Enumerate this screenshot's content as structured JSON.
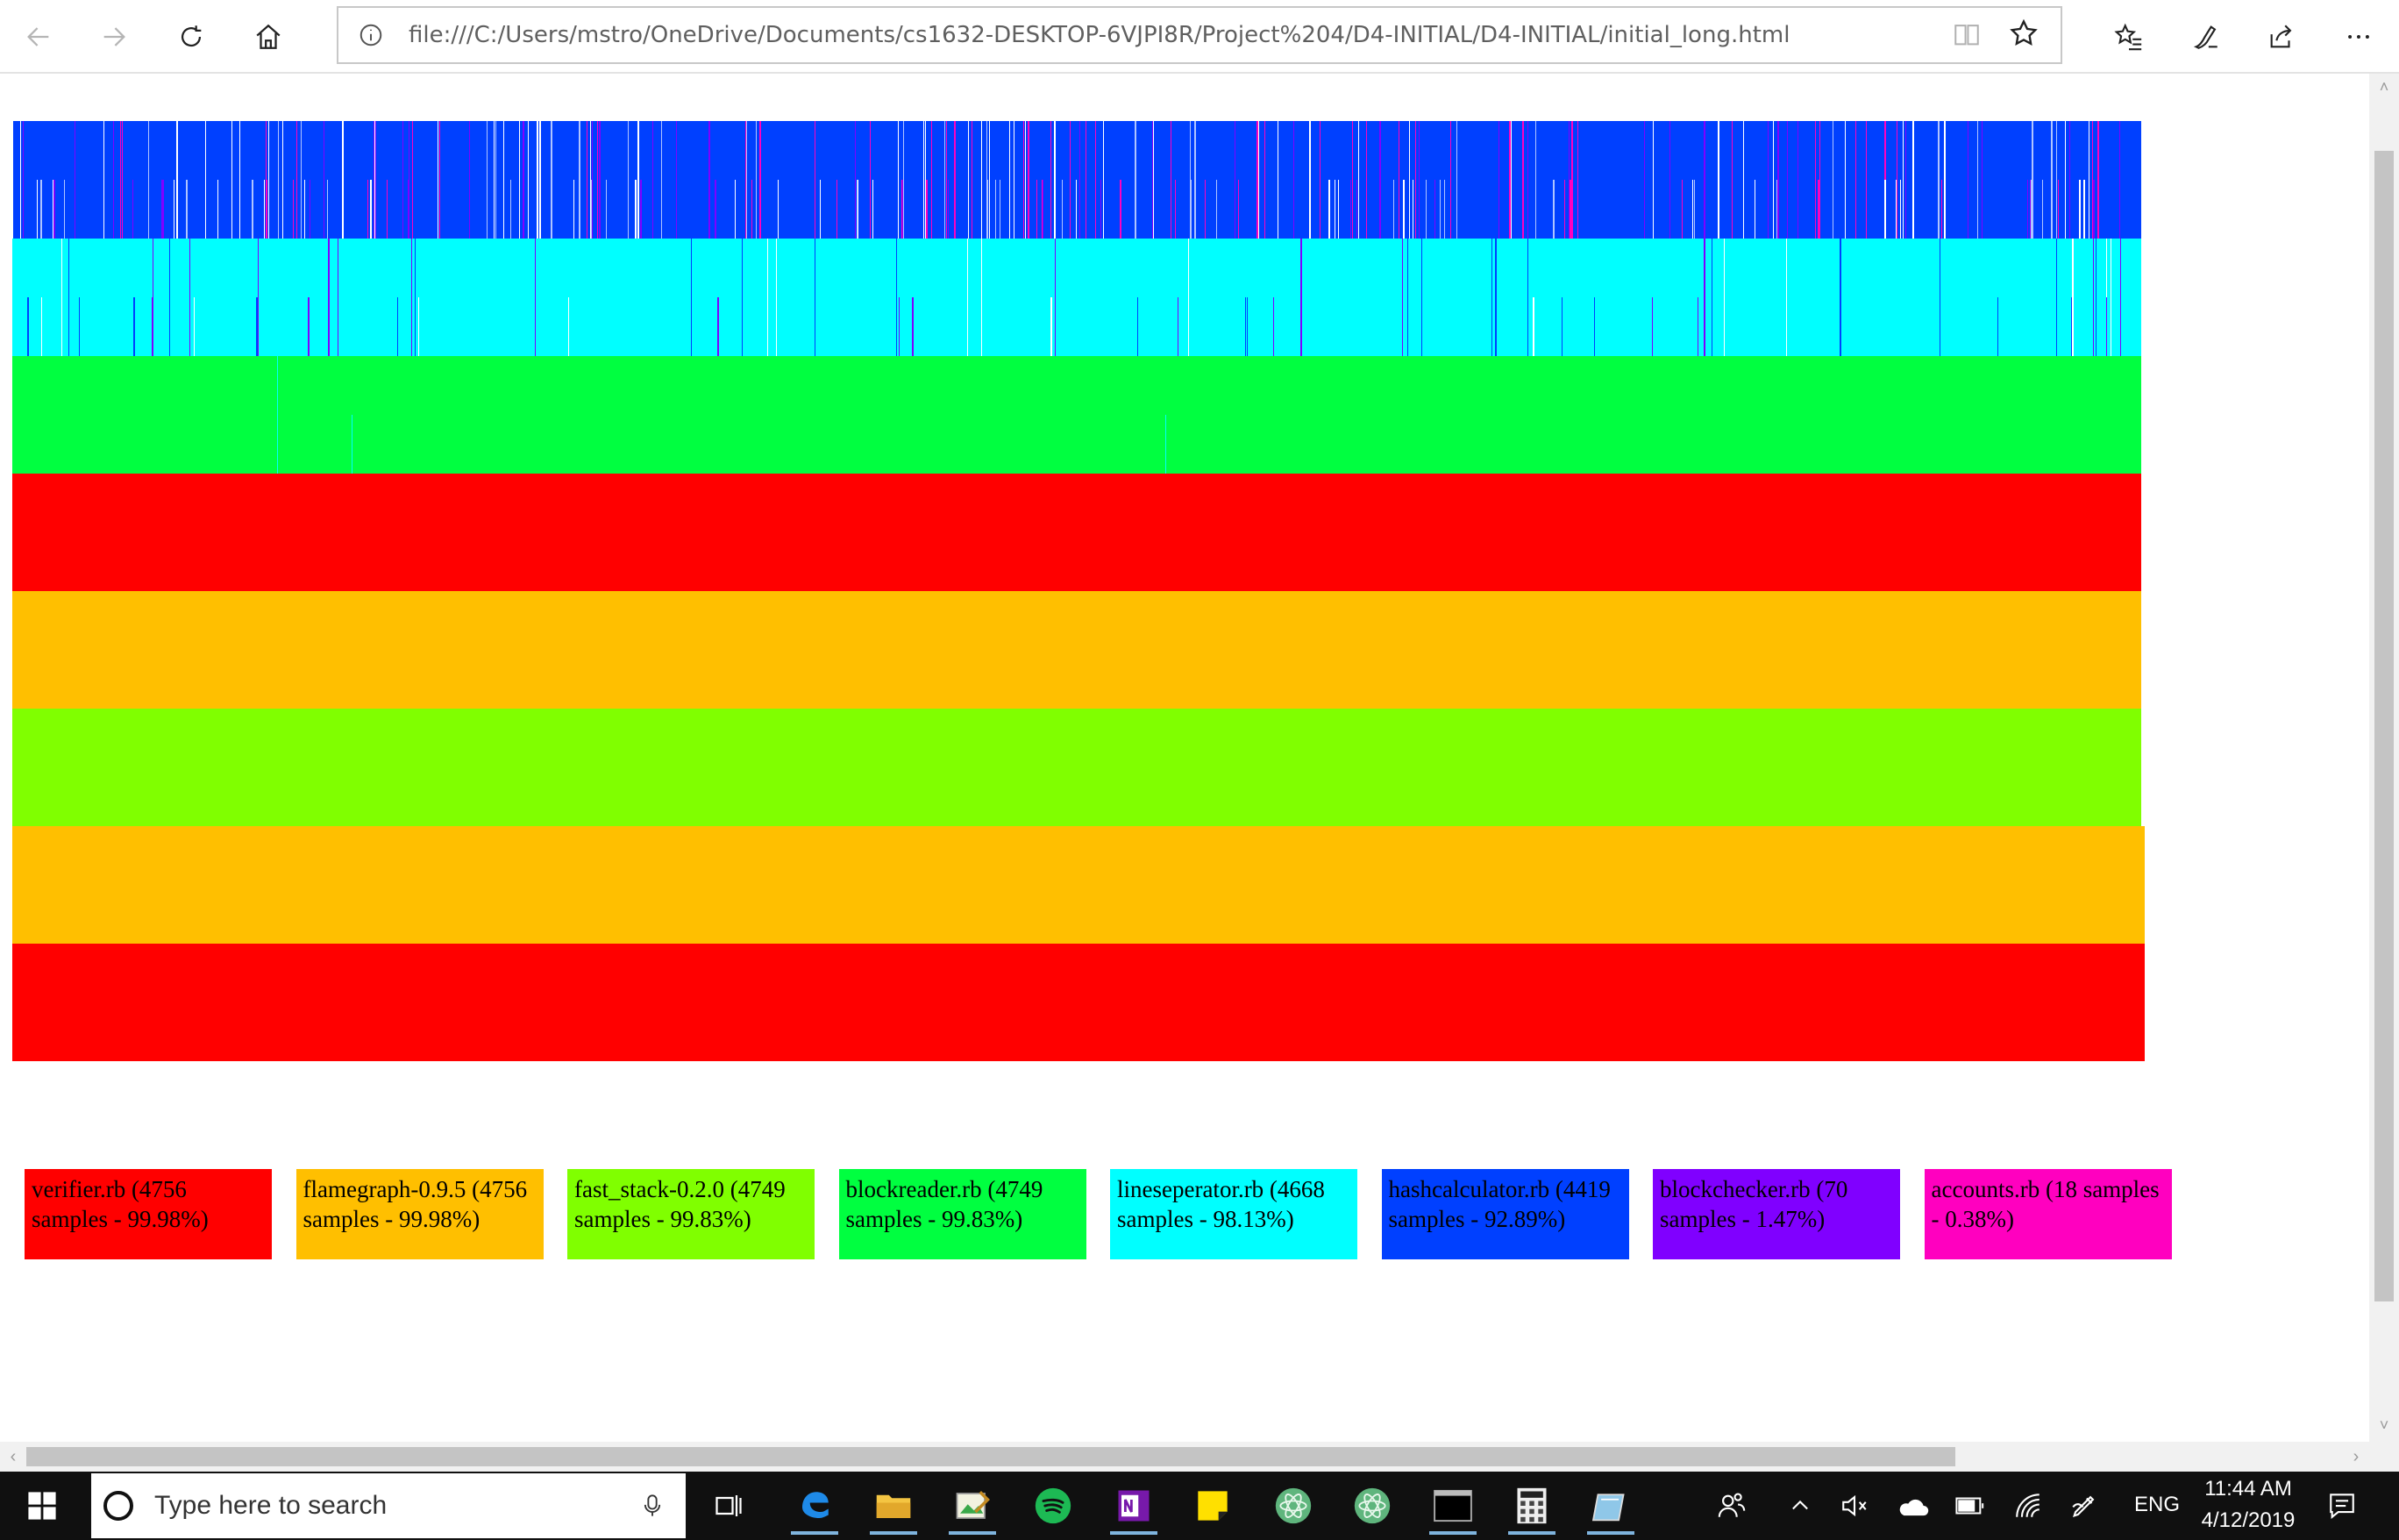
{
  "browser": {
    "url": "file:///C:/Users/mstro/OneDrive/Documents/cs1632-DESKTOP-6VJPI8R/Project%204/D4-INITIAL/D4-INITIAL/initial_long.html"
  },
  "flamegraph": {
    "rows": [
      {
        "color": "#0040ff",
        "level": 8
      },
      {
        "color": "#00ffff",
        "level": 7
      },
      {
        "color": "#00ff40",
        "level": 6
      },
      {
        "color": "#ff0000",
        "level": 5
      },
      {
        "color": "#ffbf00",
        "level": 4
      },
      {
        "color": "#80ff00",
        "level": 3
      },
      {
        "color": "#ffbf00",
        "level": 2
      },
      {
        "color": "#ff0000",
        "level": 1
      }
    ]
  },
  "legend": [
    {
      "label": "verifier.rb (4756 samples - 99.98%)",
      "color": "#ff0000"
    },
    {
      "label": "flamegraph-0.9.5 (4756 samples - 99.98%)",
      "color": "#ffbf00"
    },
    {
      "label": "fast_stack-0.2.0 (4749 samples - 99.83%)",
      "color": "#80ff00"
    },
    {
      "label": "blockreader.rb (4749 samples - 99.83%)",
      "color": "#00ff40"
    },
    {
      "label": "lineseperator.rb (4668 samples - 98.13%)",
      "color": "#00ffff"
    },
    {
      "label": "hashcalculator.rb (4419 samples - 92.89%)",
      "color": "#0040ff"
    },
    {
      "label": "blockchecker.rb (70 samples - 1.47%)",
      "color": "#8000ff"
    },
    {
      "label": "accounts.rb (18 samples - 0.38%)",
      "color": "#ff00bf"
    }
  ],
  "taskbar": {
    "search_placeholder": "Type here to search",
    "language": "ENG",
    "time": "11:44 AM",
    "date": "4/12/2019"
  }
}
